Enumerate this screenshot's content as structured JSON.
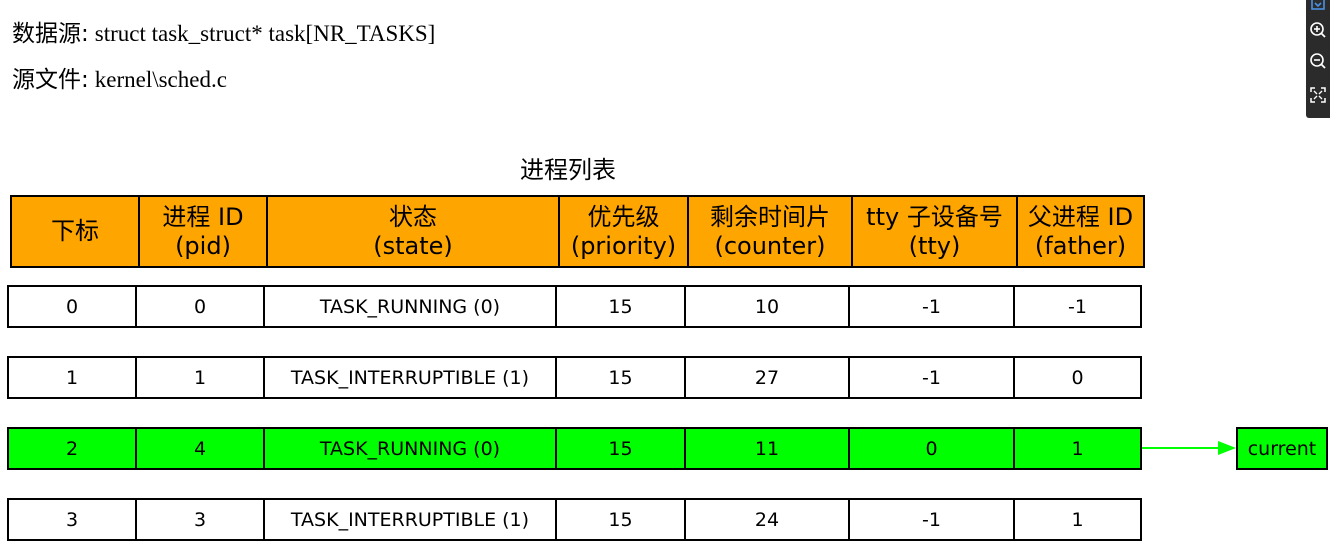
{
  "source": {
    "data_label": "数据源:",
    "data_value": "struct  task_struct*  task[NR_TASKS]",
    "file_label": "源文件:",
    "file_value": "kernel\\sched.c"
  },
  "table": {
    "caption": "进程列表",
    "headers": [
      {
        "line1": "下标",
        "line2": ""
      },
      {
        "line1": "进程 ID",
        "line2": "(pid)"
      },
      {
        "line1": "状态",
        "line2": "(state)"
      },
      {
        "line1": "优先级",
        "line2": "(priority)"
      },
      {
        "line1": "剩余时间片",
        "line2": "(counter)"
      },
      {
        "line1": "tty 子设备号",
        "line2": "(tty)"
      },
      {
        "line1": "父进程 ID",
        "line2": "(father)"
      }
    ],
    "rows": [
      {
        "cells": [
          "0",
          "0",
          "TASK_RUNNING (0)",
          "15",
          "10",
          "-1",
          "-1"
        ],
        "highlight": false
      },
      {
        "cells": [
          "1",
          "1",
          "TASK_INTERRUPTIBLE (1)",
          "15",
          "27",
          "-1",
          "0"
        ],
        "highlight": false
      },
      {
        "cells": [
          "2",
          "4",
          "TASK_RUNNING (0)",
          "15",
          "11",
          "0",
          "1"
        ],
        "highlight": true
      },
      {
        "cells": [
          "3",
          "3",
          "TASK_INTERRUPTIBLE (1)",
          "15",
          "24",
          "-1",
          "1"
        ],
        "highlight": false
      }
    ]
  },
  "pointer": {
    "label": "current",
    "color": "#00FF00"
  },
  "colors": {
    "header_bg": "#FFA500",
    "highlight_bg": "#00FF00",
    "border": "#000000"
  },
  "toolbar": {
    "icons": [
      "expand-icon",
      "zoom-in-icon",
      "zoom-out-icon",
      "fit-to-screen-icon"
    ]
  }
}
